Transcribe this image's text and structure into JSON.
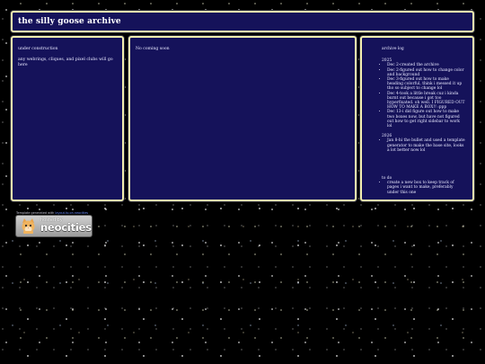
{
  "header": {
    "title": "the silly goose archive"
  },
  "left_panel": {
    "heading": "under construction",
    "text": "any webrings, cliques, and pixel clubs will go here"
  },
  "main_panel": {
    "text": "No coming soon"
  },
  "archive_log": {
    "title": "archive log",
    "years": [
      {
        "year": "2025",
        "entries": [
          "Dec 2-created the archive",
          "Dec 2-figured out how to change color and background",
          "Dec 3-figured out how to make heading colorful, think i messed it up tho so subject to change lol",
          "Dec 4-took a little break cuz i kinda burnt out because i got too hyperfixated. oh well. I FIGURED OUT HOW TO MAKE A BOX!! :ppp",
          "Dec 13-i did figure out how to make two boxes now, but have not figured out how to get right sidebar to work lol"
        ]
      },
      {
        "year": "2026",
        "entries": [
          "Jan 8-hi the bullet and used a template generator to make the base site, looks a lot better now lol"
        ]
      }
    ],
    "todo_title": "to do",
    "todo_items": [
      "create a new box to keep track of pages i want to make, preferably under this one"
    ]
  },
  "footer": {
    "prefix": "Template generated with ",
    "link_text": "layout.to.on.neocities"
  },
  "badge": {
    "hosted_label": "hosted by",
    "brand_label": "neocities"
  },
  "colors": {
    "panel_bg": "#15125a",
    "panel_border": "#f2eeb0",
    "page_bg": "#000000"
  }
}
